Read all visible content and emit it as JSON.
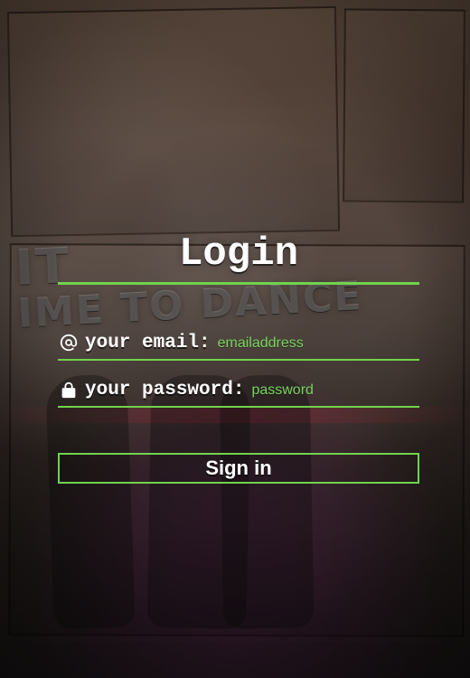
{
  "login": {
    "title": "Login",
    "email_label": "your email:",
    "email_placeholder": "emailaddress",
    "password_label": "your password:",
    "password_placeholder": "password",
    "sign_in_label": "Sign in"
  },
  "icons": {
    "email": "at-icon",
    "password": "lock-icon"
  },
  "colors": {
    "accent_green": "#71d34c",
    "placeholder_green": "#77d55e",
    "text_white": "#ffffff"
  }
}
